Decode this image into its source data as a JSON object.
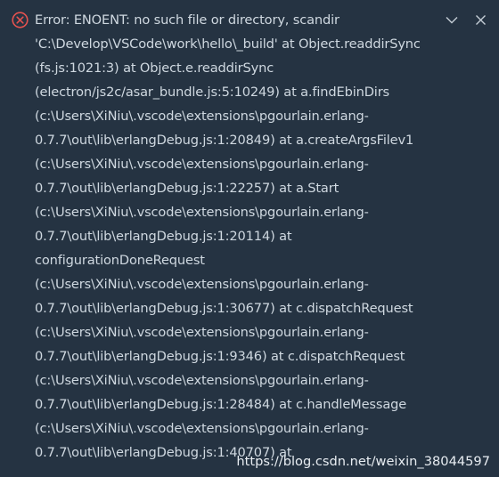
{
  "notification": {
    "severity_icon": "error-circle-x-icon",
    "error_color": "#e5524f",
    "background_color": "#253342",
    "text_color": "#cfd8e0",
    "actions": {
      "expand_icon": "chevron-down-icon",
      "close_icon": "close-icon"
    },
    "message_lines": [
      "Error: ENOENT: no such file or directory, scandir",
      "'C:\\Develop\\VSCode\\work\\hello\\_build' at Object.readdirSync",
      "(fs.js:1021:3) at Object.e.readdirSync",
      "(electron/js2c/asar_bundle.js:5:10249) at a.findEbinDirs",
      "(c:\\Users\\XiNiu\\.vscode\\extensions\\pgourlain.erlang-",
      "0.7.7\\out\\lib\\erlangDebug.js:1:20849) at a.createArgsFilev1",
      "(c:\\Users\\XiNiu\\.vscode\\extensions\\pgourlain.erlang-",
      "0.7.7\\out\\lib\\erlangDebug.js:1:22257) at a.Start",
      "(c:\\Users\\XiNiu\\.vscode\\extensions\\pgourlain.erlang-",
      "0.7.7\\out\\lib\\erlangDebug.js:1:20114) at",
      "configurationDoneRequest",
      "(c:\\Users\\XiNiu\\.vscode\\extensions\\pgourlain.erlang-",
      "0.7.7\\out\\lib\\erlangDebug.js:1:30677) at c.dispatchRequest",
      "(c:\\Users\\XiNiu\\.vscode\\extensions\\pgourlain.erlang-",
      "0.7.7\\out\\lib\\erlangDebug.js:1:9346) at c.dispatchRequest",
      "(c:\\Users\\XiNiu\\.vscode\\extensions\\pgourlain.erlang-",
      "0.7.7\\out\\lib\\erlangDebug.js:1:28484) at c.handleMessage",
      "(c:\\Users\\XiNiu\\.vscode\\extensions\\pgourlain.erlang-",
      "0.7.7\\out\\lib\\erlangDebug.js:1:40707) at"
    ]
  },
  "watermark": {
    "text": "https://blog.csdn.net/weixin_38044597"
  }
}
